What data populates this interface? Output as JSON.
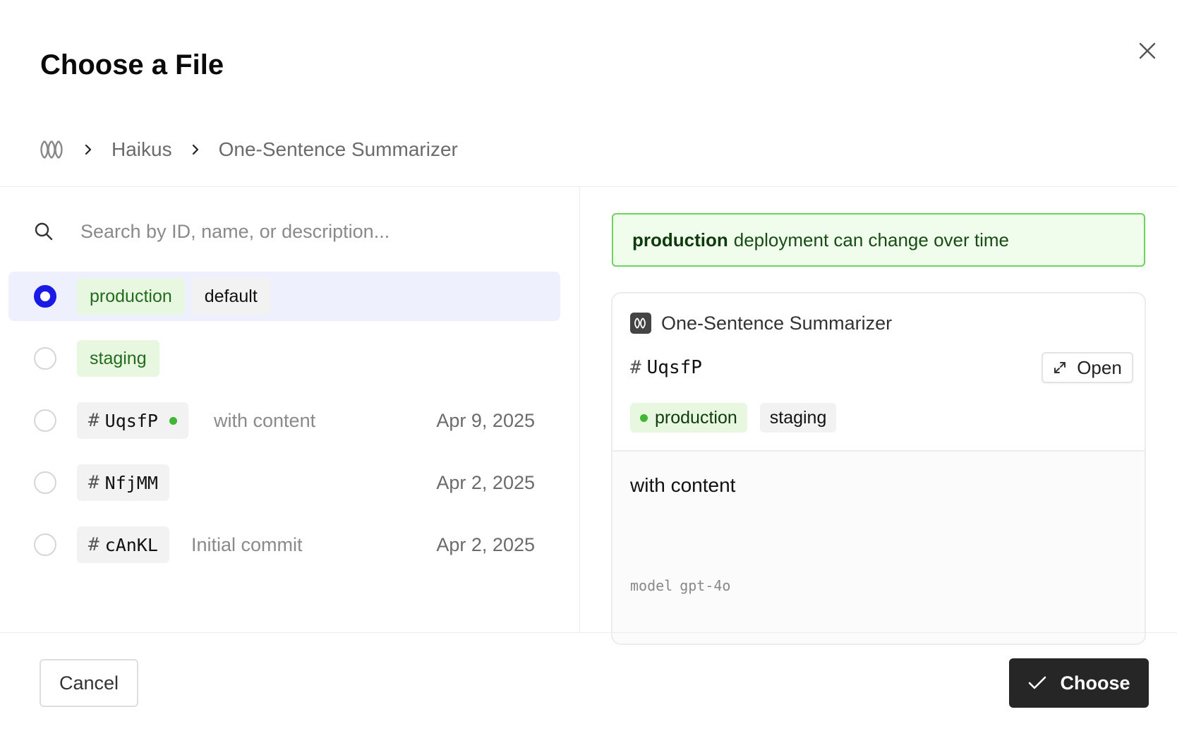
{
  "dialog": {
    "title": "Choose a File",
    "close_icon": "close-icon"
  },
  "breadcrumb": {
    "root_icon": "workspace-logo-icon",
    "items": [
      "Haikus",
      "One-Sentence Summarizer"
    ]
  },
  "search": {
    "placeholder": "Search by ID, name, or description...",
    "value": ""
  },
  "versions": [
    {
      "tags": [
        "production",
        "default"
      ],
      "selected": true
    },
    {
      "tags": [
        "staging"
      ],
      "selected": false
    },
    {
      "id": "UqsfP",
      "live": true,
      "description": "with content",
      "date": "Apr 9, 2025",
      "selected": false
    },
    {
      "id": "NfjMM",
      "description": "",
      "date": "Apr 2, 2025",
      "selected": false
    },
    {
      "id": "cAnKL",
      "description": "Initial commit",
      "date": "Apr 2, 2025",
      "selected": false
    }
  ],
  "banner": {
    "env": "production",
    "message": "deployment can change over time"
  },
  "preview": {
    "file_name": "One-Sentence Summarizer",
    "id": "UqsfP",
    "open_label": "Open",
    "tags": [
      "production",
      "staging"
    ],
    "content": "with content",
    "model_label": "model",
    "model_value": "gpt-4o"
  },
  "footer": {
    "cancel_label": "Cancel",
    "choose_label": "Choose"
  },
  "colors": {
    "accent": "#1a1ae6",
    "success": "#3fb634",
    "primary_button": "#262626"
  }
}
